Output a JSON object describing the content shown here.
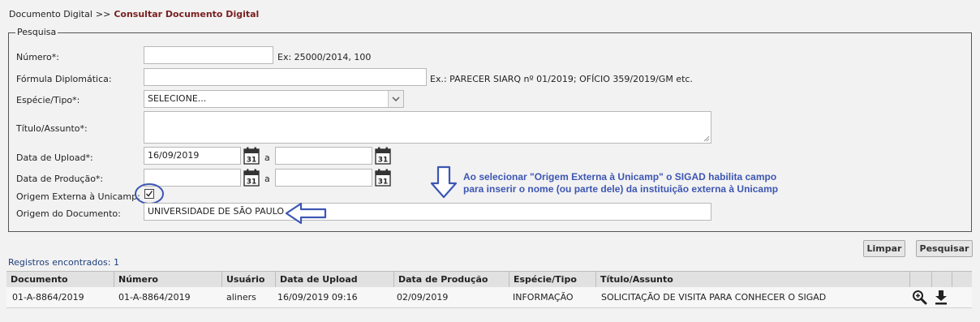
{
  "breadcrumb": {
    "root": "Documento Digital",
    "separator": ">>",
    "current": "Consultar Documento Digital"
  },
  "search": {
    "legend": "Pesquisa",
    "numero": {
      "label": "Número*:",
      "value": "",
      "hint": "Ex: 25000/2014, 100"
    },
    "formula": {
      "label": "Fórmula Diplomática:",
      "value": "",
      "hint": "Ex.: PARECER SIARQ nº 01/2019; OFÍCIO 359/2019/GM etc."
    },
    "especie": {
      "label": "Espécie/Tipo*:",
      "selected": "SELECIONE..."
    },
    "titulo": {
      "label": "Título/Assunto*:",
      "value": ""
    },
    "upload": {
      "label": "Data de Upload*:",
      "from": "16/09/2019",
      "to": "",
      "separator": "a"
    },
    "producao": {
      "label": "Data de Produção*:",
      "from": "",
      "to": "",
      "separator": "a"
    },
    "origem_externa": {
      "label": "Origem Externa à Unicamp:",
      "checked": true
    },
    "origem_documento": {
      "label": "Origem do Documento:",
      "value": "UNIVERSIDADE DE SÃO PAULO"
    },
    "calendar_icon_text": "31"
  },
  "annotation": {
    "line1": "Ao selecionar \"Origem Externa à Unicamp\" o SIGAD habilita campo",
    "line2": "para inserir o nome (ou parte dele) da instituição externa à Unicamp",
    "color": "#3d56b3"
  },
  "buttons": {
    "limpar": "Limpar",
    "pesquisar": "Pesquisar"
  },
  "results": {
    "count_label": "Registros encontrados: 1",
    "columns": [
      "Documento",
      "Número",
      "Usuário",
      "Data de Upload",
      "Data de Produção",
      "Espécie/Tipo",
      "Título/Assunto",
      "",
      "",
      ""
    ],
    "rows": [
      {
        "documento": "01-A-8864/2019",
        "numero": "01-A-8864/2019",
        "usuario": "aliners",
        "data_upload": "16/09/2019 09:16",
        "data_producao": "02/09/2019",
        "especie": "INFORMAÇÃO",
        "titulo": "SOLICITAÇÃO DE VISITA PARA CONHECER O SIGAD",
        "actions": [
          "zoom-icon",
          "download-icon"
        ]
      }
    ]
  }
}
